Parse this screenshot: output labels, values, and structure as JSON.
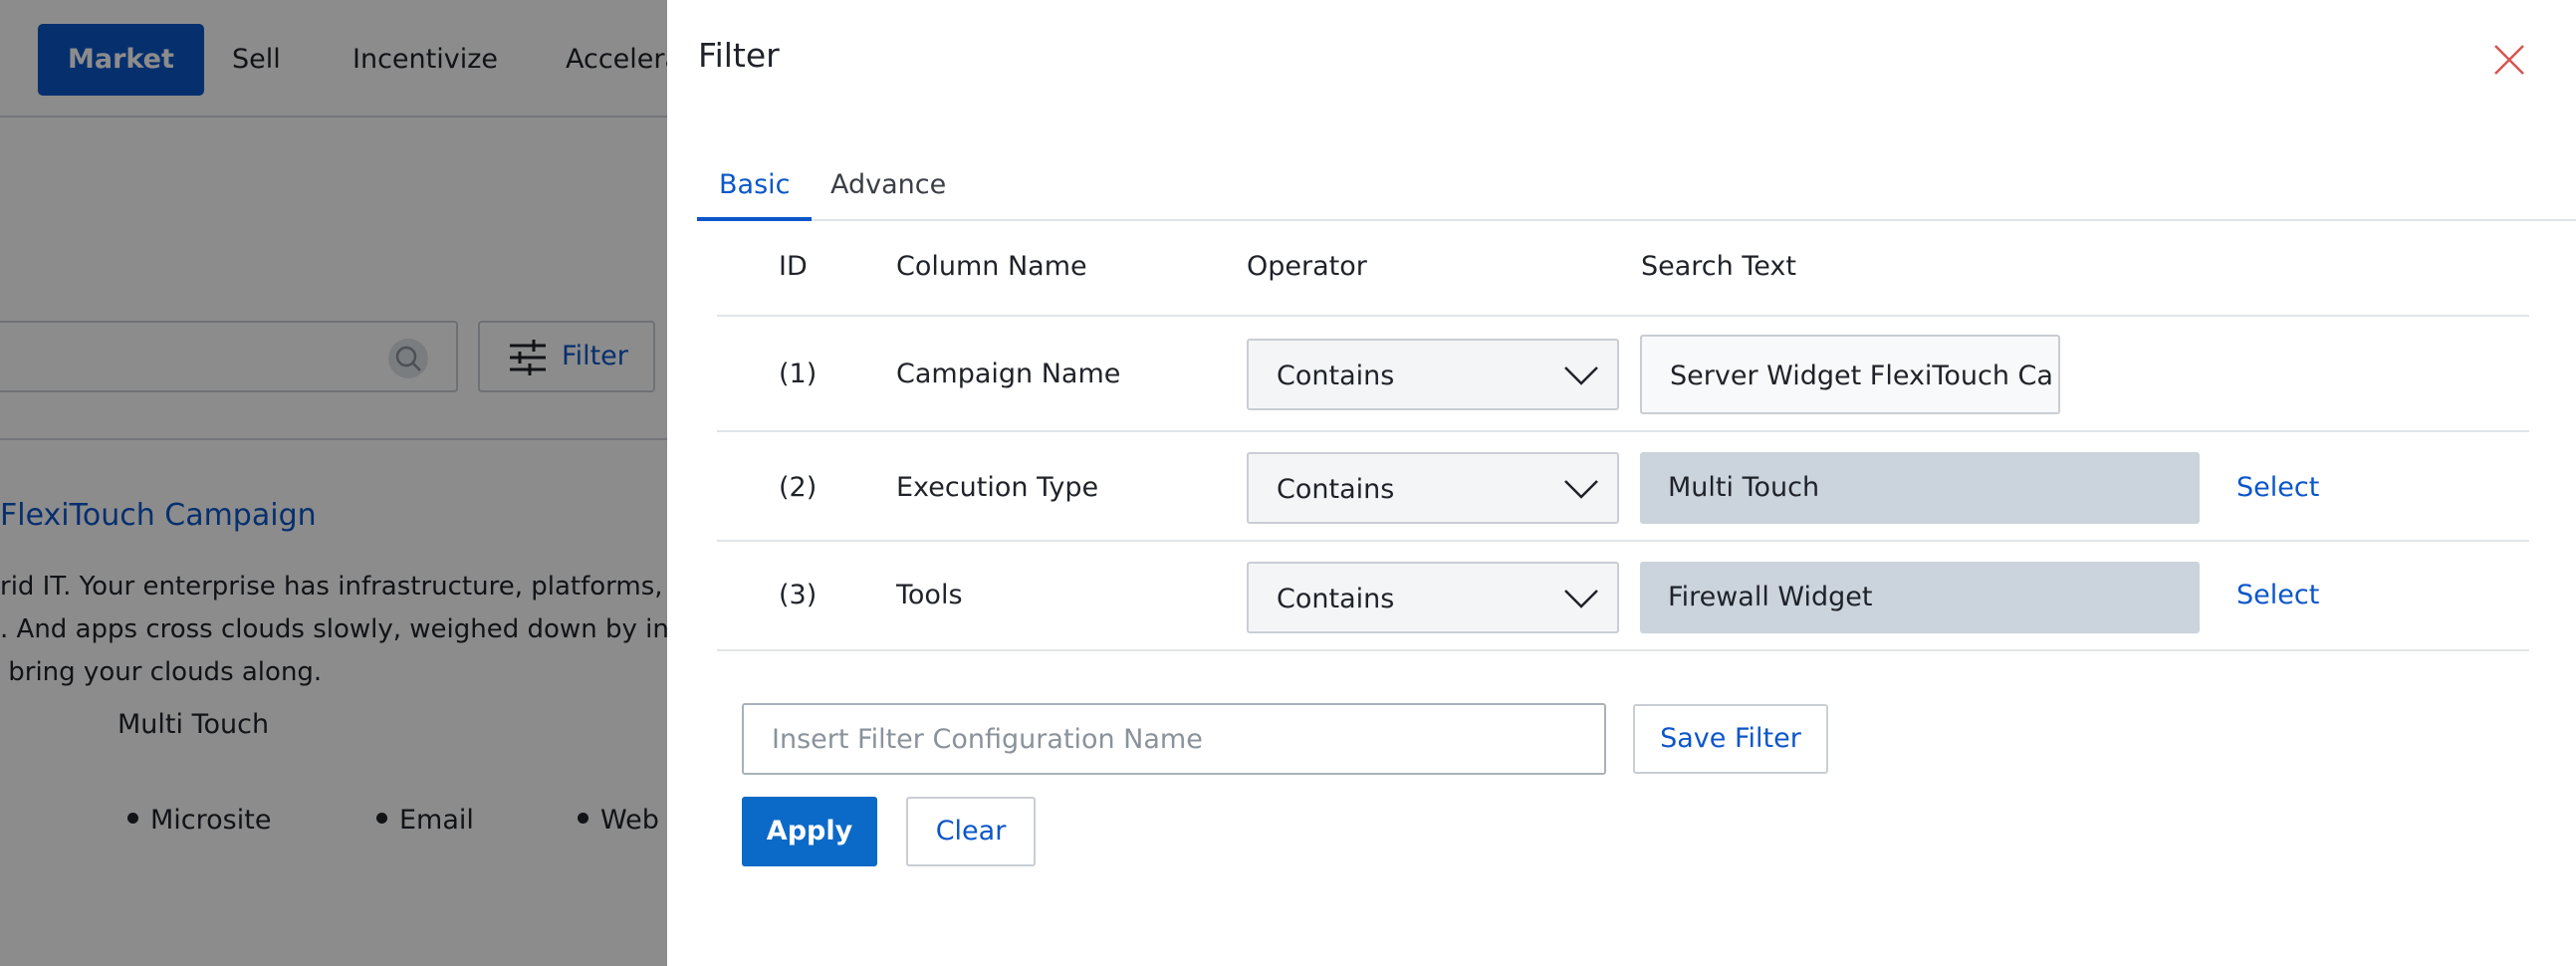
{
  "background": {
    "nav": {
      "items": [
        {
          "label": "Market",
          "active": true
        },
        {
          "label": "Sell",
          "active": false
        },
        {
          "label": "Incentivize",
          "active": false
        },
        {
          "label": "Accelera",
          "active": false
        }
      ]
    },
    "filter_button_label": "Filter",
    "campaign": {
      "title": "FlexiTouch Campaign",
      "description": "rid IT. Your enterprise has infrastructure, platforms, ap\n. And apps cross clouds slowly, weighed down by info\n bring your clouds along.",
      "execution_type": "Multi Touch",
      "channels": [
        "Microsite",
        "Email",
        "Web S"
      ]
    }
  },
  "drawer": {
    "title": "Filter",
    "tabs": [
      {
        "label": "Basic",
        "active": true
      },
      {
        "label": "Advance",
        "active": false
      }
    ],
    "columns": {
      "id": "ID",
      "column_name": "Column Name",
      "operator": "Operator",
      "search_text": "Search Text"
    },
    "rows": [
      {
        "id": "(1)",
        "column_name": "Campaign Name",
        "operator": "Contains",
        "search_text": "Server Widget FlexiTouch Ca",
        "select_label": ""
      },
      {
        "id": "(2)",
        "column_name": "Execution Type",
        "operator": "Contains",
        "search_text": "Multi Touch",
        "select_label": "Select"
      },
      {
        "id": "(3)",
        "column_name": "Tools",
        "operator": "Contains",
        "search_text": "Firewall Widget",
        "select_label": "Select"
      }
    ],
    "config_name_placeholder": "Insert Filter Configuration Name",
    "save_filter_label": "Save Filter",
    "apply_label": "Apply",
    "clear_label": "Clear"
  },
  "colors": {
    "accent": "#0b56c9",
    "primary_button": "#0b6ac7",
    "close_icon": "#d9534f",
    "readonly_field": "#cbd3dc"
  },
  "icons": {
    "close": "close-icon",
    "dropdown": "chevron-down-icon",
    "search": "search-icon",
    "filter": "sliders-icon"
  }
}
